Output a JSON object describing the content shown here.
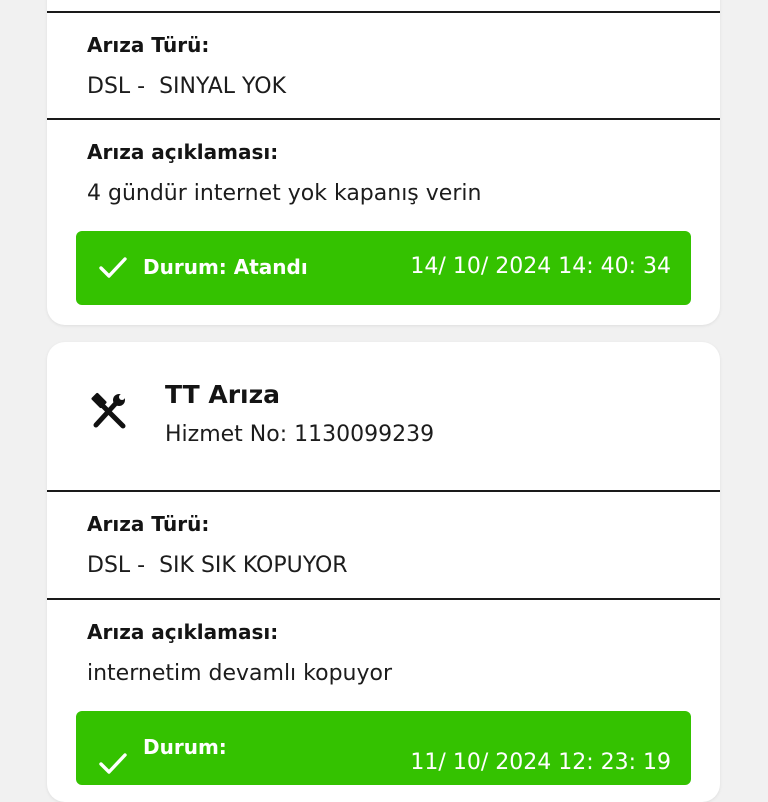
{
  "colors": {
    "background": "#f1f1f1",
    "card": "#ffffff",
    "status_green": "#34c200",
    "divider": "#1a1a1a"
  },
  "cards": [
    {
      "fault_type_label": "Arıza Türü:",
      "fault_type_value": "DSL -  SINYAL YOK",
      "description_label": "Arıza açıklaması:",
      "description_value": "4 gündür internet yok kapanış verin",
      "status_label": "Durum: Atandı",
      "status_date": "14/ 10/ 2024 14: 40: 34",
      "status_icon": "check-icon"
    },
    {
      "icon": "tools-icon",
      "title": "TT Arıza",
      "service_no": "Hizmet No: 1130099239",
      "fault_type_label": "Arıza Türü:",
      "fault_type_value": "DSL -  SIK SIK KOPUYOR",
      "description_label": "Arıza açıklaması:",
      "description_value": "internetim devamlı kopuyor",
      "status_label": "Durum:",
      "status_date": "11/ 10/ 2024 12: 23: 19",
      "status_icon": "check-icon"
    }
  ]
}
